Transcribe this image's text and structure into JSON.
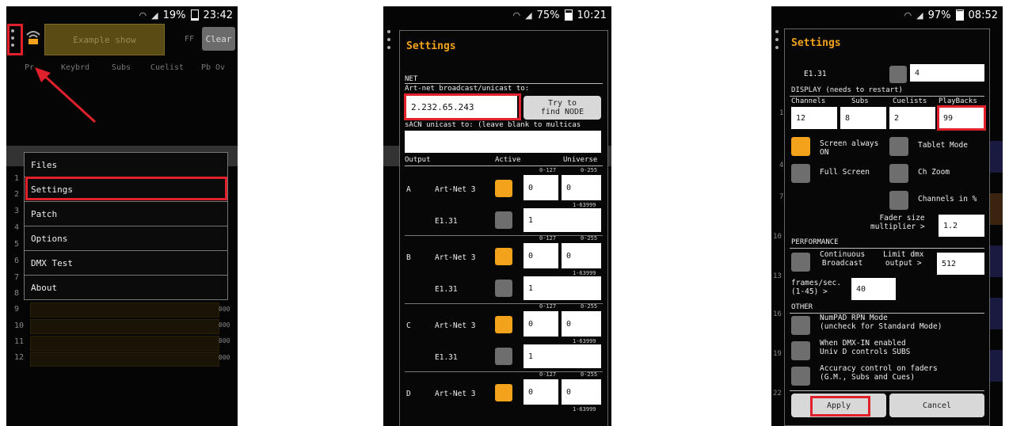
{
  "p1": {
    "status": {
      "percent": "19%",
      "time": "23:42"
    },
    "show_name": "Example show",
    "ff": "FF",
    "clear": "Clear",
    "tabs": [
      "Pr",
      "Keybrd",
      "Subs",
      "Cuelist",
      "Pb Ov"
    ],
    "menu": [
      "Files",
      "Settings",
      "Patch",
      "Options",
      "DMX Test",
      "About"
    ],
    "rows": [
      "1",
      "2",
      "3",
      "4",
      "5",
      "6",
      "7",
      "8",
      "9",
      "10",
      "11",
      "12"
    ],
    "row_values": [
      "000",
      "000",
      "000",
      "000"
    ]
  },
  "p2": {
    "status": {
      "percent": "75%",
      "time": "10:21"
    },
    "title": "Settings",
    "net": "NET",
    "artnet_label": "Art-net broadcast/unicast to:",
    "ip_value": "2.232.65.243",
    "find_node": "Try to\nfind NODE",
    "sacn_label": "sACN unicast to: (leave blank to multicas",
    "hdr_output": "Output",
    "hdr_active": "Active",
    "hdr_universe": "Universe",
    "range_127": "0-127",
    "range_255": "0-255",
    "range_63999": "1-63999",
    "outputs": [
      {
        "letter": "A",
        "artnet": "Art-Net 3",
        "v1": "0",
        "v2": "0",
        "e131": "E1.31",
        "ev": "1"
      },
      {
        "letter": "B",
        "artnet": "Art-Net 3",
        "v1": "0",
        "v2": "0",
        "e131": "E1.31",
        "ev": "1"
      },
      {
        "letter": "C",
        "artnet": "Art-Net 3",
        "v1": "0",
        "v2": "0",
        "e131": "E1.31",
        "ev": "1"
      },
      {
        "letter": "D",
        "artnet": "Art-Net 3",
        "v1": "0",
        "v2": "0"
      }
    ]
  },
  "p3": {
    "status": {
      "percent": "97%",
      "time": "08:52"
    },
    "title": "Settings",
    "e131": "E1.31",
    "e131_value": "4",
    "display": "DISPLAY (needs to restart)",
    "col_channels": "Channels",
    "col_subs": "Subs",
    "col_cuelists": "Cuelists",
    "col_playbacks": "PlayBacks",
    "val_channels": "12",
    "val_subs": "8",
    "val_cuelists": "2",
    "val_playbacks": "99",
    "screen_on": "Screen always\nON",
    "tablet_mode": "Tablet Mode",
    "full_screen": "Full Screen",
    "ch_zoom": "Ch Zoom",
    "channels_pct": "Channels in %",
    "fader_size": "Fader size\nmultiplier >",
    "fader_value": "1.2",
    "performance": "PERFORMANCE",
    "continuous": "Continuous\nBroadcast",
    "limit_dmx": "Limit dmx\noutput >",
    "limit_value": "512",
    "fps_label": "frames/sec.\n(1-45) >",
    "fps_value": "40",
    "other": "OTHER",
    "numpad": "NumPAD RPN Mode\n(uncheck for Standard Mode)",
    "dmx_in": "When DMX-IN enabled\nUniv D controls SUBS",
    "accuracy": "Accuracy control on faders\n(G.M., Subs and Cues)",
    "apply": "Apply",
    "cancel": "Cancel",
    "side_numbers": [
      "1",
      "4",
      "7",
      "10",
      "13",
      "16",
      "19",
      "22"
    ]
  },
  "colors": {
    "accent": "#f2a21b",
    "highlight": "#e0202a",
    "checkbox_off": "#6e6e6e"
  }
}
